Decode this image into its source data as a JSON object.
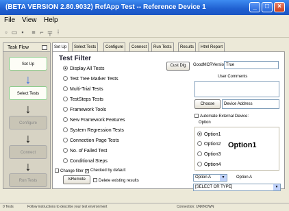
{
  "window": {
    "title": "(BETA VERSION 2.80.9032) RefApp Test -- Reference Device 1"
  },
  "menu": [
    "File",
    "View",
    "Help"
  ],
  "taskflow": {
    "header": "Task Flow",
    "steps": [
      "Set Up",
      "Select Tests",
      "Configure",
      "Connect",
      "Run Tests"
    ]
  },
  "tabs": [
    "Set Up",
    "Select Tests",
    "Configure",
    "Connect",
    "Run Tests",
    "Results",
    "Html Report"
  ],
  "filter": {
    "title": "Test Filter",
    "options": [
      "Display All Tests",
      "Test Tree Marker Tests",
      "Multi-Trial Tests",
      "TestSteps Tests",
      "Framework Tools",
      "New Framework Features",
      "System Regression Tests",
      "Connection Page Tests",
      "No. of Failed Test",
      "Conditional Steps"
    ],
    "selected_index": 0,
    "change_filter": "Change filter",
    "checked_by_default": "Checked by default",
    "isremote": "IsRemote",
    "delete_existing": "Delete existing results"
  },
  "right": {
    "cust_dlg": "Cust Dlg",
    "good_mcr_label": "GoodMCRVersion",
    "good_mcr_value": "True",
    "user_comments": "User Comments",
    "choose": "Choose",
    "device_address": "Device Address",
    "automate": "Automate External Device:",
    "option_label": "Option",
    "options": [
      "Option1",
      "Option2",
      "Option3",
      "Option4"
    ],
    "selected_option": "Option1",
    "drop1": "Option A",
    "drop1_label": "Option A",
    "drop2": "[SELECT OR TYPE]"
  },
  "status": {
    "tests": "0 Tests",
    "message": "Follow instructions to describe your test environment",
    "connection": "Connection: UNKNOWN"
  }
}
